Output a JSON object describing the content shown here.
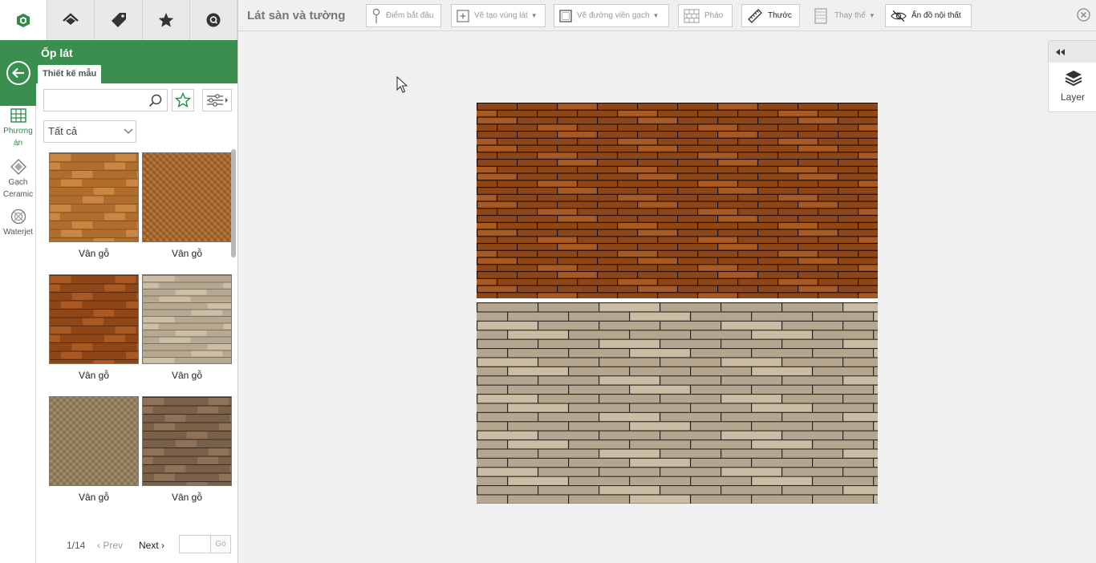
{
  "left_panel": {
    "top_tabs": [
      {
        "icon": "home-3d-logo-icon",
        "active": true
      },
      {
        "icon": "house-floor-icon",
        "active": false
      },
      {
        "icon": "tag-icon",
        "active": false
      },
      {
        "icon": "star-icon",
        "active": false
      },
      {
        "icon": "chat-search-icon",
        "active": false
      }
    ],
    "title": "Ốp lát",
    "subtab": "Thiết kế mẫu",
    "rail": {
      "phuong_an": "Phương án",
      "gach_ceramic": "Gạch Ceramic",
      "waterjet": "Waterjet"
    },
    "search": {
      "value": "",
      "placeholder": ""
    },
    "category": {
      "selected": "Tất cả"
    },
    "tiles": [
      {
        "label": "Vân gỗ",
        "pattern": "brick",
        "colors": [
          "#b06d2c",
          "#c88743",
          "#8a5420"
        ]
      },
      {
        "label": "Vân gỗ",
        "pattern": "herringbone",
        "colors": [
          "#9c5f28",
          "#b9793c",
          "#7a461a"
        ]
      },
      {
        "label": "Vân gỗ",
        "pattern": "brick",
        "colors": [
          "#8f4616",
          "#a95a22",
          "#5a2b0d"
        ]
      },
      {
        "label": "Vân gỗ",
        "pattern": "plank",
        "colors": [
          "#b7a991",
          "#cdbfa6",
          "#7d7261"
        ]
      },
      {
        "label": "Vân gỗ",
        "pattern": "herringbone",
        "colors": [
          "#8e7a5a",
          "#a08b69",
          "#6a5a41"
        ]
      },
      {
        "label": "Vân gỗ",
        "pattern": "brick",
        "colors": [
          "#7a6048",
          "#8f7258",
          "#3c2e22"
        ]
      }
    ],
    "pagination": {
      "indicator": "1/14",
      "prev": "Prev",
      "next": "Next",
      "go": "Go",
      "page_input": ""
    }
  },
  "toolbar": {
    "title": "Lát sàn và tường",
    "buttons": {
      "start_point": "Điểm bắt đầu",
      "draw_area": "Vẽ tạo vùng lát",
      "draw_border": "Vẽ đường viền gạch",
      "trim": "Phào",
      "ruler": "Thước",
      "replace": "Thay thế",
      "hide_furniture": "Ẩn đồ nội thất"
    }
  },
  "layer_panel": {
    "label": "Layer"
  },
  "canvas": {
    "top_tile_colors": [
      "#8f4616",
      "#a95a22",
      "#1d0f05"
    ],
    "bottom_tile_colors": [
      "#b5a78f",
      "#cbbda4",
      "#2b2722"
    ]
  }
}
